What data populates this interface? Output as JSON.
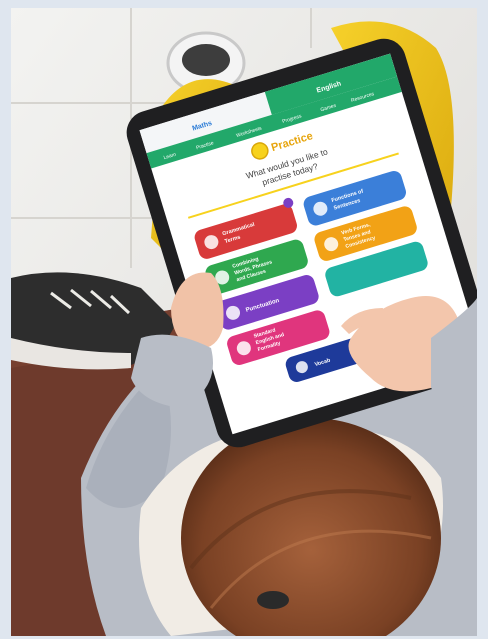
{
  "tablet": {
    "tabs": {
      "maths": "Maths",
      "english": "English"
    },
    "nav": [
      "Learn",
      "Practise",
      "Worksheets",
      "Progress",
      "Games",
      "Resources"
    ],
    "header_title": "Practice",
    "prompt_line1": "What would you like to",
    "prompt_line2": "practise today?",
    "tiles": [
      {
        "label_1": "Grammatical",
        "label_2": "Terms",
        "color": "#d83a3a"
      },
      {
        "label_1": "Functions of",
        "label_2": "Sentences",
        "color": "#3b7fd9"
      },
      {
        "label_1": "Combining",
        "label_2": "Words, Phrases",
        "label_3": "and Clauses",
        "color": "#2fa84f"
      },
      {
        "label_1": "Verb Forms,",
        "label_2": "Tenses and",
        "label_3": "Consistency",
        "color": "#f2a216"
      },
      {
        "label_1": "Punctuation",
        "color": "#7b3fc4"
      },
      {
        "label_1": "Standard",
        "label_2": "English and",
        "label_3": "Formality",
        "color": "#e0357d"
      },
      {
        "label_1": "Vocab",
        "color": "#1e3a9a"
      }
    ],
    "accent_green": "#22a86a",
    "header_yellow": "#f7d21d"
  }
}
